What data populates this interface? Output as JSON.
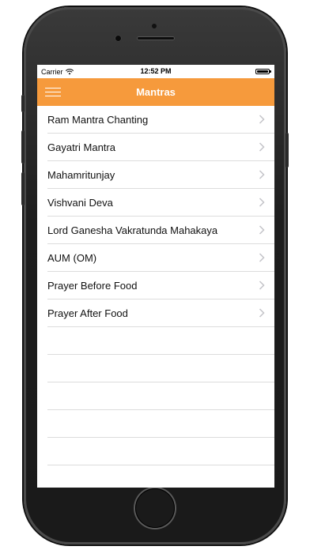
{
  "status_bar": {
    "carrier": "Carrier",
    "time": "12:52 PM",
    "wifi_icon": "wifi-icon",
    "battery_icon": "battery-icon"
  },
  "nav_bar": {
    "title": "Mantras",
    "menu_icon": "hamburger-menu-icon",
    "color": "#f69a3c"
  },
  "mantras": {
    "items": [
      {
        "label": "Ram Mantra Chanting"
      },
      {
        "label": "Gayatri Mantra"
      },
      {
        "label": "Mahamritunjay"
      },
      {
        "label": "Vishvani Deva"
      },
      {
        "label": "Lord Ganesha Vakratunda Mahakaya"
      },
      {
        "label": "AUM (OM)"
      },
      {
        "label": "Prayer Before Food"
      },
      {
        "label": "Prayer After Food"
      }
    ],
    "chevron_icon": "chevron-right-icon"
  }
}
